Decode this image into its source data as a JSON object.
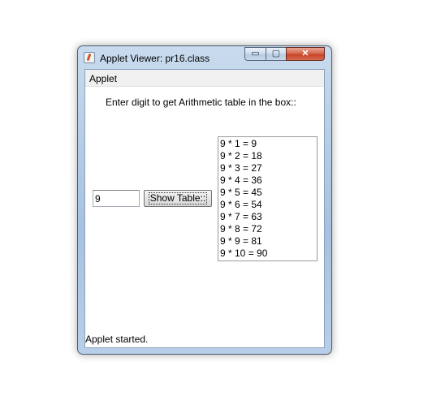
{
  "window": {
    "title": "Applet Viewer: pr16.class",
    "minimize_symbol": "▭",
    "maximize_symbol": "▢",
    "close_symbol": "✕"
  },
  "menu": {
    "applet_label": "Applet"
  },
  "main": {
    "prompt": "Enter digit to get Arithmetic table in the box::",
    "digit_value": "9",
    "show_button_label": "Show Table::",
    "table_lines": [
      "9 * 1 = 9",
      "9 * 2 = 18",
      "9 * 3 = 27",
      "9 * 4 = 36",
      "9 * 5 = 45",
      "9 * 6 = 54",
      "9 * 7 = 63",
      "9 * 8 = 72",
      "9 * 9 = 81",
      "9 * 10 = 90"
    ]
  },
  "status": {
    "text": "Applet started."
  },
  "icons": {
    "app": "java-icon",
    "minimize": "minimize-icon",
    "maximize": "maximize-icon",
    "close": "close-icon"
  }
}
